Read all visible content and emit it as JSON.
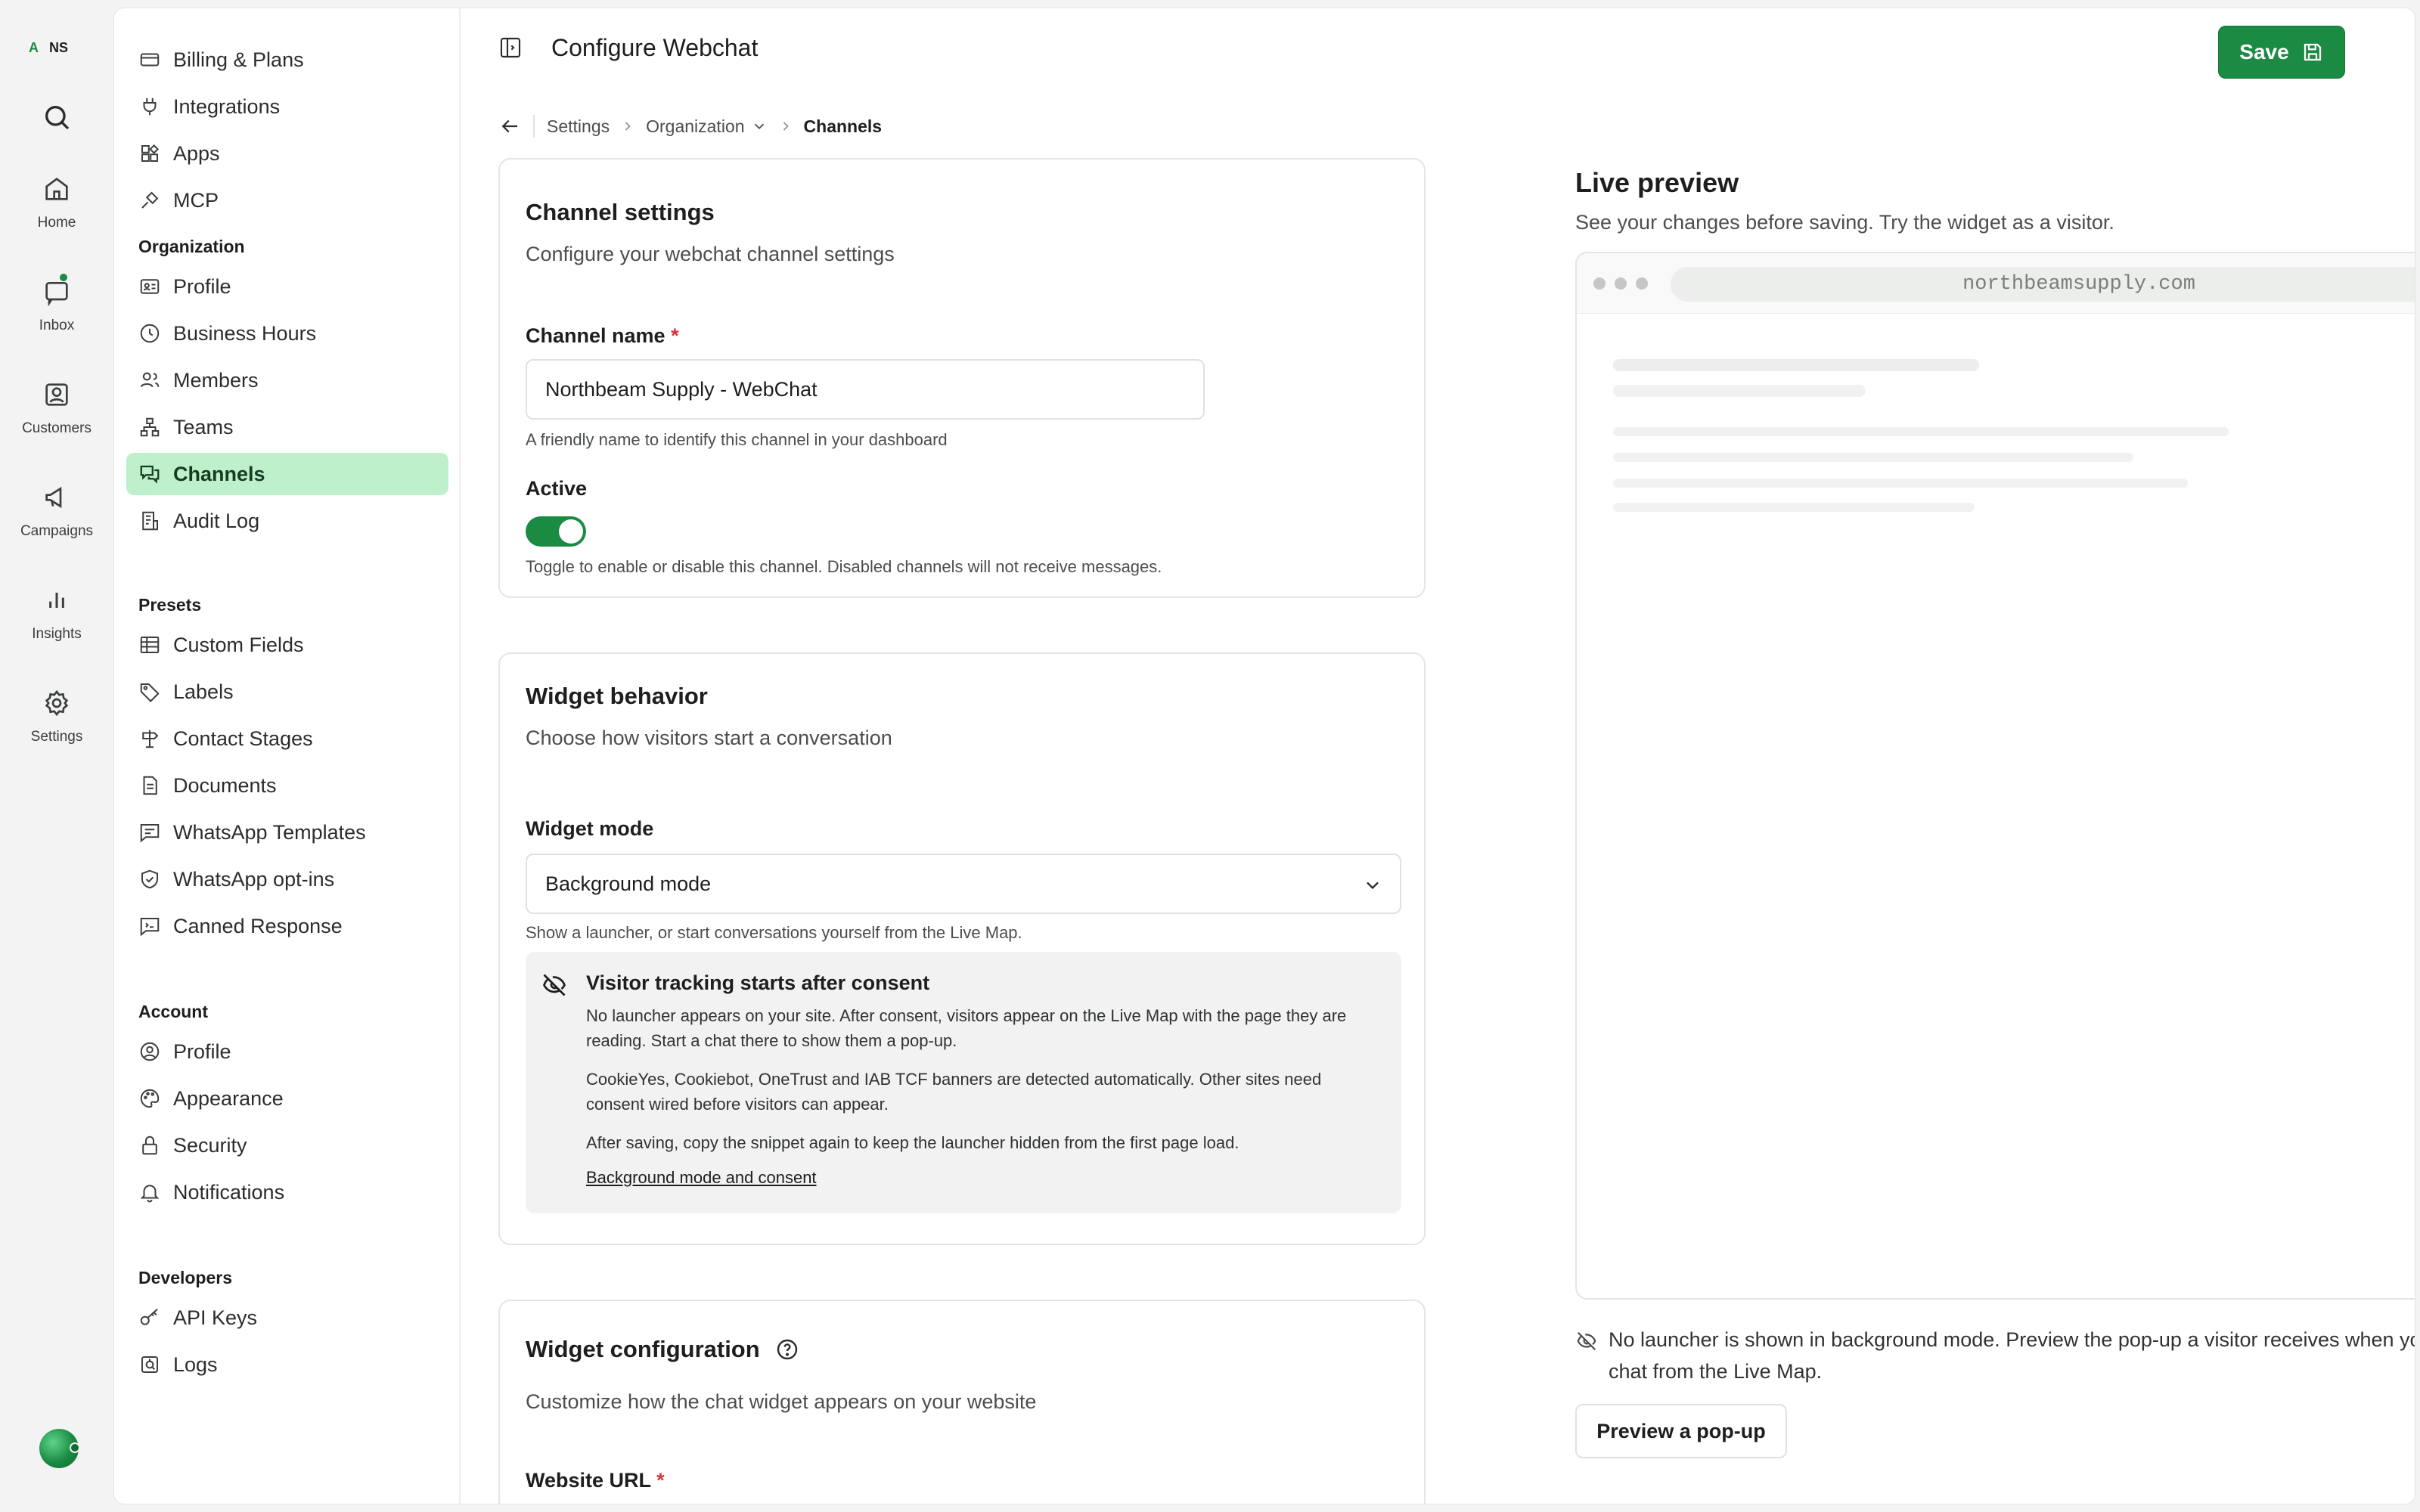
{
  "workspace": {
    "initial_a": "A",
    "initial_ns": "NS"
  },
  "rail": {
    "items": [
      {
        "label": "Home",
        "icon": "home-icon"
      },
      {
        "label": "Inbox",
        "icon": "inbox-icon"
      },
      {
        "label": "Customers",
        "icon": "customers-icon"
      },
      {
        "label": "Campaigns",
        "icon": "megaphone-icon"
      },
      {
        "label": "Insights",
        "icon": "chart-icon"
      },
      {
        "label": "Settings",
        "icon": "gear-icon"
      }
    ]
  },
  "sidenav": {
    "top_items": [
      {
        "label": "Billing & Plans",
        "icon": "credit-card-icon"
      },
      {
        "label": "Integrations",
        "icon": "plug-icon"
      },
      {
        "label": "Apps",
        "icon": "apps-icon"
      },
      {
        "label": "MCP",
        "icon": "mcp-icon"
      }
    ],
    "organization_heading": "Organization",
    "organization_items": [
      {
        "label": "Profile",
        "icon": "id-card-icon"
      },
      {
        "label": "Business Hours",
        "icon": "clock-icon"
      },
      {
        "label": "Members",
        "icon": "users-icon"
      },
      {
        "label": "Teams",
        "icon": "network-icon"
      },
      {
        "label": "Channels",
        "icon": "chat-bubbles-icon",
        "active": true
      },
      {
        "label": "Audit Log",
        "icon": "log-icon"
      }
    ],
    "presets_heading": "Presets",
    "presets_items": [
      {
        "label": "Custom Fields",
        "icon": "table-icon"
      },
      {
        "label": "Labels",
        "icon": "tag-icon"
      },
      {
        "label": "Contact Stages",
        "icon": "signpost-icon"
      },
      {
        "label": "Documents",
        "icon": "document-icon"
      },
      {
        "label": "WhatsApp Templates",
        "icon": "template-icon"
      },
      {
        "label": "WhatsApp opt-ins",
        "icon": "shield-check-icon"
      },
      {
        "label": "Canned Response",
        "icon": "canned-response-icon"
      }
    ],
    "account_heading": "Account",
    "account_items": [
      {
        "label": "Profile",
        "icon": "user-circle-icon"
      },
      {
        "label": "Appearance",
        "icon": "palette-icon"
      },
      {
        "label": "Security",
        "icon": "lock-icon"
      },
      {
        "label": "Notifications",
        "icon": "bell-icon"
      }
    ],
    "developers_heading": "Developers",
    "developers_items": [
      {
        "label": "API Keys",
        "icon": "key-icon"
      },
      {
        "label": "Logs",
        "icon": "logs-icon"
      }
    ]
  },
  "header": {
    "title": "Configure Webchat",
    "save_label": "Save"
  },
  "breadcrumb": {
    "settings": "Settings",
    "organization": "Organization",
    "current": "Channels"
  },
  "channel_settings": {
    "title": "Channel settings",
    "subtitle": "Configure your webchat channel settings",
    "name_label": "Channel name",
    "required_mark": "*",
    "name_value": "Northbeam Supply - WebChat",
    "name_help": "A friendly name to identify this channel in your dashboard",
    "active_label": "Active",
    "active_on": true,
    "active_help": "Toggle to enable or disable this channel. Disabled channels will not receive messages."
  },
  "widget_behavior": {
    "title": "Widget behavior",
    "subtitle": "Choose how visitors start a conversation",
    "mode_label": "Widget mode",
    "mode_value": "Background mode",
    "mode_help": "Show a launcher, or start conversations yourself from the Live Map.",
    "notice": {
      "title": "Visitor tracking starts after consent",
      "p1": "No launcher appears on your site. After consent, visitors appear on the Live Map with the page they are reading. Start a chat there to show them a pop-up.",
      "p2": "CookieYes, Cookiebot, OneTrust and IAB TCF banners are detected automatically. Other sites need consent wired before visitors can appear.",
      "p3": "After saving, copy the snippet again to keep the launcher hidden from the first page load.",
      "link": "Background mode and consent"
    }
  },
  "widget_configuration": {
    "title": "Widget configuration",
    "subtitle": "Customize how the chat widget appears on your website",
    "url_label": "Website URL",
    "required_mark": "*"
  },
  "preview": {
    "title": "Live preview",
    "subtitle": "See your changes before saving. Try the widget as a visitor.",
    "url": "northbeamsupply.com",
    "note": "No launcher is shown in background mode. Preview the pop-up a visitor receives when you start a chat from the Live Map.",
    "button": "Preview a pop-up"
  },
  "colors": {
    "accent": "#1b8a43",
    "active_nav_bg": "#bff0cc",
    "required": "#d6323a"
  }
}
